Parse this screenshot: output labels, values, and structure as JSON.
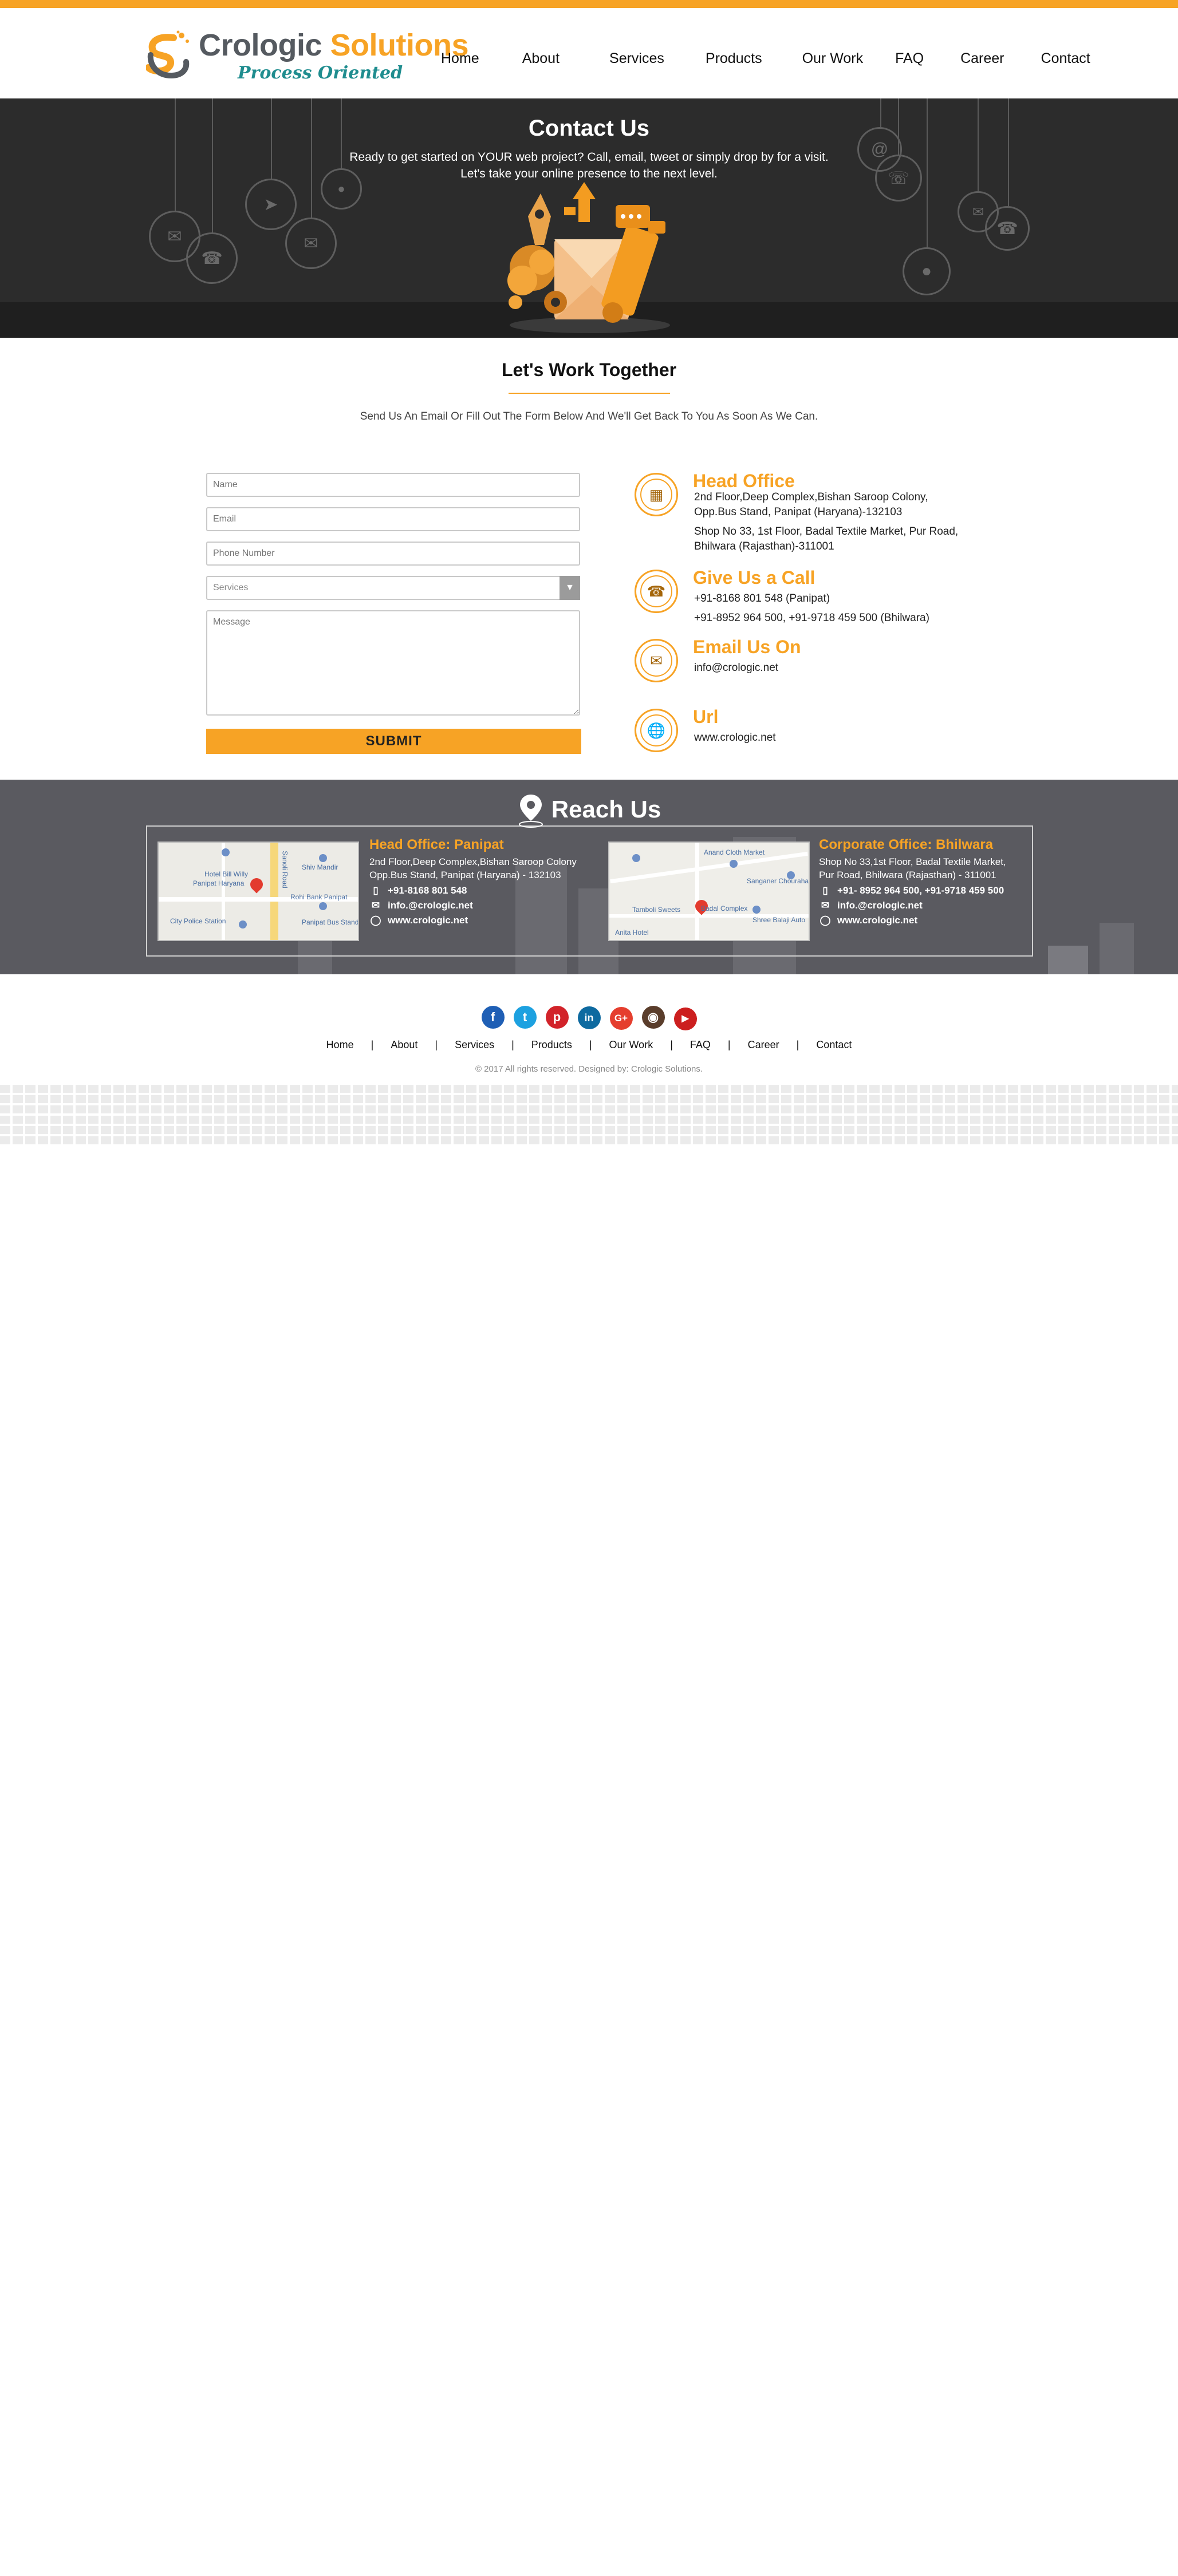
{
  "brand": {
    "name_part1": "Crologic",
    "name_part2": "Solutions",
    "tagline": "Process Oriented",
    "accent_color": "#f7a325",
    "teal_color": "#1f8d8f"
  },
  "nav": [
    "Home",
    "About",
    "Services",
    "Products",
    "Our Work",
    "FAQ",
    "Career",
    "Contact"
  ],
  "hero": {
    "title": "Contact Us",
    "line1": "Ready to get started on YOUR web project? Call, email, tweet or simply drop by for a visit.",
    "line2": "Let's take your online presence to the next level."
  },
  "work": {
    "title": "Let's Work Together",
    "subtitle": "Send Us An Email Or Fill Out The Form Below And We'll Get Back To You As Soon As We Can."
  },
  "form": {
    "name_placeholder": "Name",
    "email_placeholder": "Email",
    "phone_placeholder": "Phone Number",
    "services_value": "Services",
    "message_placeholder": "Message",
    "submit_label": "SUBMIT"
  },
  "info": {
    "head_office": {
      "title": "Head Office",
      "line1": "2nd Floor,Deep Complex,Bishan Saroop Colony,",
      "line2": "Opp.Bus Stand, Panipat (Haryana)-132103",
      "line3": "Shop No 33, 1st Floor, Badal Textile Market, Pur Road,",
      "line4": "Bhilwara (Rajasthan)-311001"
    },
    "call": {
      "title": "Give Us a Call",
      "line1": "+91-8168 801 548 (Panipat)",
      "line2": "+91-8952 964 500, +91-9718 459 500 (Bhilwara)"
    },
    "email": {
      "title": "Email Us On",
      "line1": "info@crologic.net"
    },
    "url": {
      "title": "Url",
      "line1": "www.crologic.net"
    }
  },
  "reach": {
    "title": "Reach Us",
    "panipat": {
      "title": "Head Office: Panipat",
      "addr1": "2nd Floor,Deep Complex,Bishan Saroop Colony",
      "addr2": "Opp.Bus Stand, Panipat (Haryana) - 132103",
      "phone": "+91-8168 801 548",
      "email": "info.@crologic.net",
      "url": "www.crologic.net",
      "map_labels": [
        "Hotel Bill Willy",
        "Panipat Haryana",
        "Shiv Mandir",
        "Rohi Bank Panipat",
        "City Police Station",
        "Panipat Bus Stand",
        "Sanoli Road"
      ]
    },
    "bhilwara": {
      "title": "Corporate Office: Bhilwara",
      "addr1": "Shop No 33,1st Floor, Badal Textile Market,",
      "addr2": "Pur Road, Bhilwara (Rajasthan) - 311001",
      "phone": "+91- 8952 964 500, +91-9718 459 500",
      "email": "info.@crologic.net",
      "url": "www.crologic.net",
      "map_labels": [
        "Anand Cloth Market",
        "Sanganer Chouraha",
        "Badal Complex",
        "Shree Balaji Auto",
        "Tamboli Sweets",
        "Anita Hotel"
      ]
    }
  },
  "social": [
    "facebook-icon",
    "twitter-icon",
    "pinterest-icon",
    "linkedin-icon",
    "google-plus-icon",
    "instagram-icon",
    "youtube-icon"
  ],
  "footer_nav": [
    "Home",
    "About",
    "Services",
    "Products",
    "Our Work",
    "FAQ",
    "Career",
    "Contact"
  ],
  "copyright": "© 2017 All rights reserved. Designed by: Crologic Solutions."
}
